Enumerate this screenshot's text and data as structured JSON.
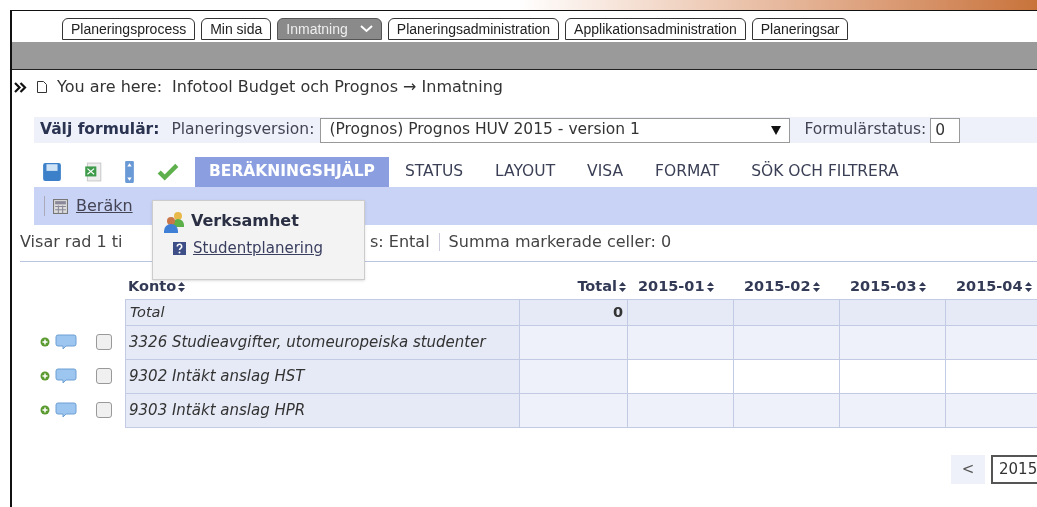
{
  "top_tabs": [
    {
      "label": "Planeringsprocess",
      "selected": false,
      "dropdown": false
    },
    {
      "label": "Min sida",
      "selected": false,
      "dropdown": false
    },
    {
      "label": "Inmatning",
      "selected": true,
      "dropdown": true
    },
    {
      "label": "Planeringsadministration",
      "selected": false,
      "dropdown": false
    },
    {
      "label": "Applikationsadministration",
      "selected": false,
      "dropdown": false
    },
    {
      "label": "Planeringsar",
      "selected": false,
      "dropdown": false
    }
  ],
  "breadcrumb": {
    "prefix": "You are here:",
    "path": [
      "Infotool Budget och Prognos",
      "Inmatning"
    ],
    "separator": "→"
  },
  "form_bar": {
    "title": "Välj formulär:",
    "version_label": "Planeringsversion:",
    "version_value": "(Prognos) Prognos HUV 2015 - version 1",
    "status_label": "Formulärstatus:",
    "status_value": "0"
  },
  "toolbar_tabs": [
    {
      "label": "BERÄKNINGSHJÄLP",
      "selected": true
    },
    {
      "label": "STATUS",
      "selected": false
    },
    {
      "label": "LAYOUT",
      "selected": false
    },
    {
      "label": "VISA",
      "selected": false
    },
    {
      "label": "FORMAT",
      "selected": false
    },
    {
      "label": "SÖK OCH FILTRERA",
      "selected": false
    }
  ],
  "subbar": {
    "link": "Beräkn"
  },
  "status_line": {
    "rows_text": "Visar rad 1 ti",
    "format_text": "s: Ental",
    "sum_text": "Summa markerade celler: 0"
  },
  "popup": {
    "title": "Verksamhet",
    "item": "Studentplanering"
  },
  "table": {
    "columns": [
      "Konto",
      "Total",
      "2015-01",
      "2015-02",
      "2015-03",
      "2015-04"
    ],
    "total_row": {
      "label": "Total",
      "total": "0"
    },
    "rows": [
      {
        "label": "3326 Studieavgifter, utomeuropeiska studenter",
        "checked": false
      },
      {
        "label": "9302 Intäkt anslag HST",
        "checked": false
      },
      {
        "label": "9303 Intäkt anslag HPR",
        "checked": false
      }
    ]
  },
  "pager": {
    "prev": "<",
    "value": "2015"
  }
}
